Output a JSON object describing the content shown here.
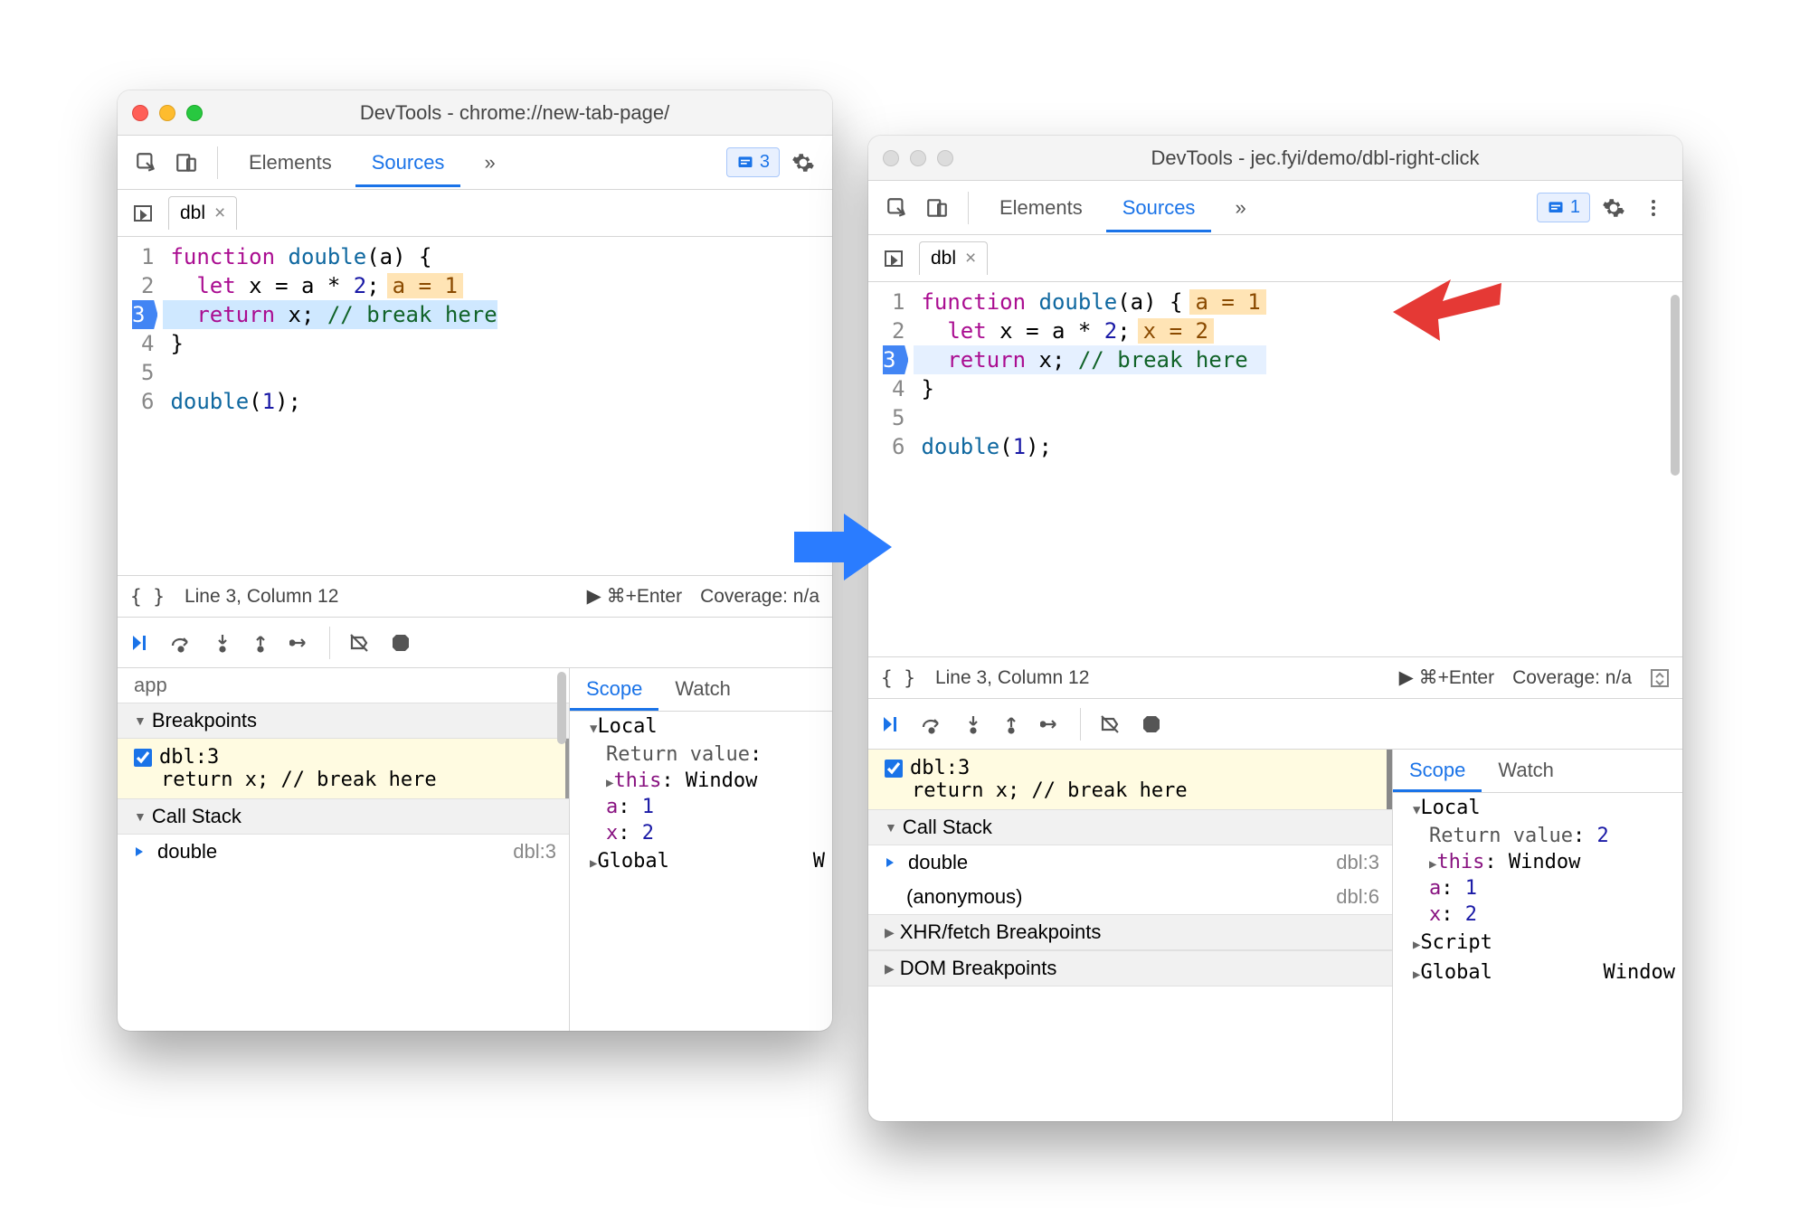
{
  "window1": {
    "title": "DevTools - chrome://new-tab-page/",
    "mac_buttons_active": true,
    "toolbar": {
      "tabs": [
        "Elements",
        "Sources"
      ],
      "active": "Sources",
      "more": "»",
      "issues_count": "3"
    },
    "file_tab": {
      "name": "dbl",
      "close": "×"
    },
    "code": {
      "lines": [
        "1",
        "2",
        "3",
        "4",
        "5",
        "6"
      ],
      "l1_kw": "function",
      "l1_fn": " double",
      "l1_rest": "(a) {",
      "l2_pre": "  ",
      "l2_kw": "let",
      "l2_rest": " x = a * ",
      "l2_num": "2",
      "l2_semi": ";",
      "l2_inline": "a = 1",
      "l3_pre": "  ",
      "l3_kw": "return",
      "l3_rest": " x; ",
      "l3_com": "// break here",
      "l4": "}",
      "l5": "",
      "l6_fn": "double",
      "l6_open": "(",
      "l6_num": "1",
      "l6_close": ");"
    },
    "status": {
      "braces": "{ }",
      "pos": "Line 3, Column 12",
      "run": "▶ ⌘+Enter",
      "coverage": "Coverage: n/a"
    },
    "left_panel": {
      "row0": "app",
      "breakpoints_header": "Breakpoints",
      "bp_label": "dbl:3",
      "bp_code": "return x; // break here",
      "callstack_header": "Call Stack",
      "stack_fn": "double",
      "stack_loc": "dbl:3"
    },
    "scope": {
      "tabs": [
        "Scope",
        "Watch"
      ],
      "active": "Scope",
      "local": "Local",
      "retval_label": "Return value",
      "retval": ":",
      "this_label": "this",
      "this_val": "Window",
      "a_label": "a",
      "a_val": "1",
      "x_label": "x",
      "x_val": "2",
      "global": "Global",
      "global_val": "W"
    }
  },
  "window2": {
    "title": "DevTools - jec.fyi/demo/dbl-right-click",
    "toolbar": {
      "tabs": [
        "Elements",
        "Sources"
      ],
      "active": "Sources",
      "more": "»",
      "issues_count": "1"
    },
    "file_tab": {
      "name": "dbl",
      "close": "×"
    },
    "code": {
      "lines": [
        "1",
        "2",
        "3",
        "4",
        "5",
        "6"
      ],
      "l1_kw": "function",
      "l1_fn": " double",
      "l1_rest": "(a) {",
      "l1_inline": "a = 1",
      "l2_pre": "  ",
      "l2_kw": "let",
      "l2_rest": " x = a * ",
      "l2_num": "2",
      "l2_semi": ";",
      "l2_inline": "x = 2",
      "l3_pre": "  ",
      "l3_kw": "return",
      "l3_rest": " x; ",
      "l3_com": "// break here",
      "l4": "}",
      "l5": "",
      "l6_fn": "double",
      "l6_open": "(",
      "l6_num": "1",
      "l6_close": ");"
    },
    "status": {
      "braces": "{ }",
      "pos": "Line 3, Column 12",
      "run": "▶ ⌘+Enter",
      "coverage": "Coverage: n/a"
    },
    "left_panel": {
      "bp_label": "dbl:3",
      "bp_code": "return x; // break here",
      "callstack_header": "Call Stack",
      "stack_fn1": "double",
      "stack_loc1": "dbl:3",
      "stack_fn2": "(anonymous)",
      "stack_loc2": "dbl:6",
      "xhr_header": "XHR/fetch Breakpoints",
      "dom_header": "DOM Breakpoints"
    },
    "scope": {
      "tabs": [
        "Scope",
        "Watch"
      ],
      "active": "Scope",
      "local": "Local",
      "retval_label": "Return value",
      "retval_val": "2",
      "this_label": "this",
      "this_val": "Window",
      "a_label": "a",
      "a_val": "1",
      "x_label": "x",
      "x_val": "2",
      "script": "Script",
      "global": "Global",
      "global_val": "Window"
    }
  }
}
